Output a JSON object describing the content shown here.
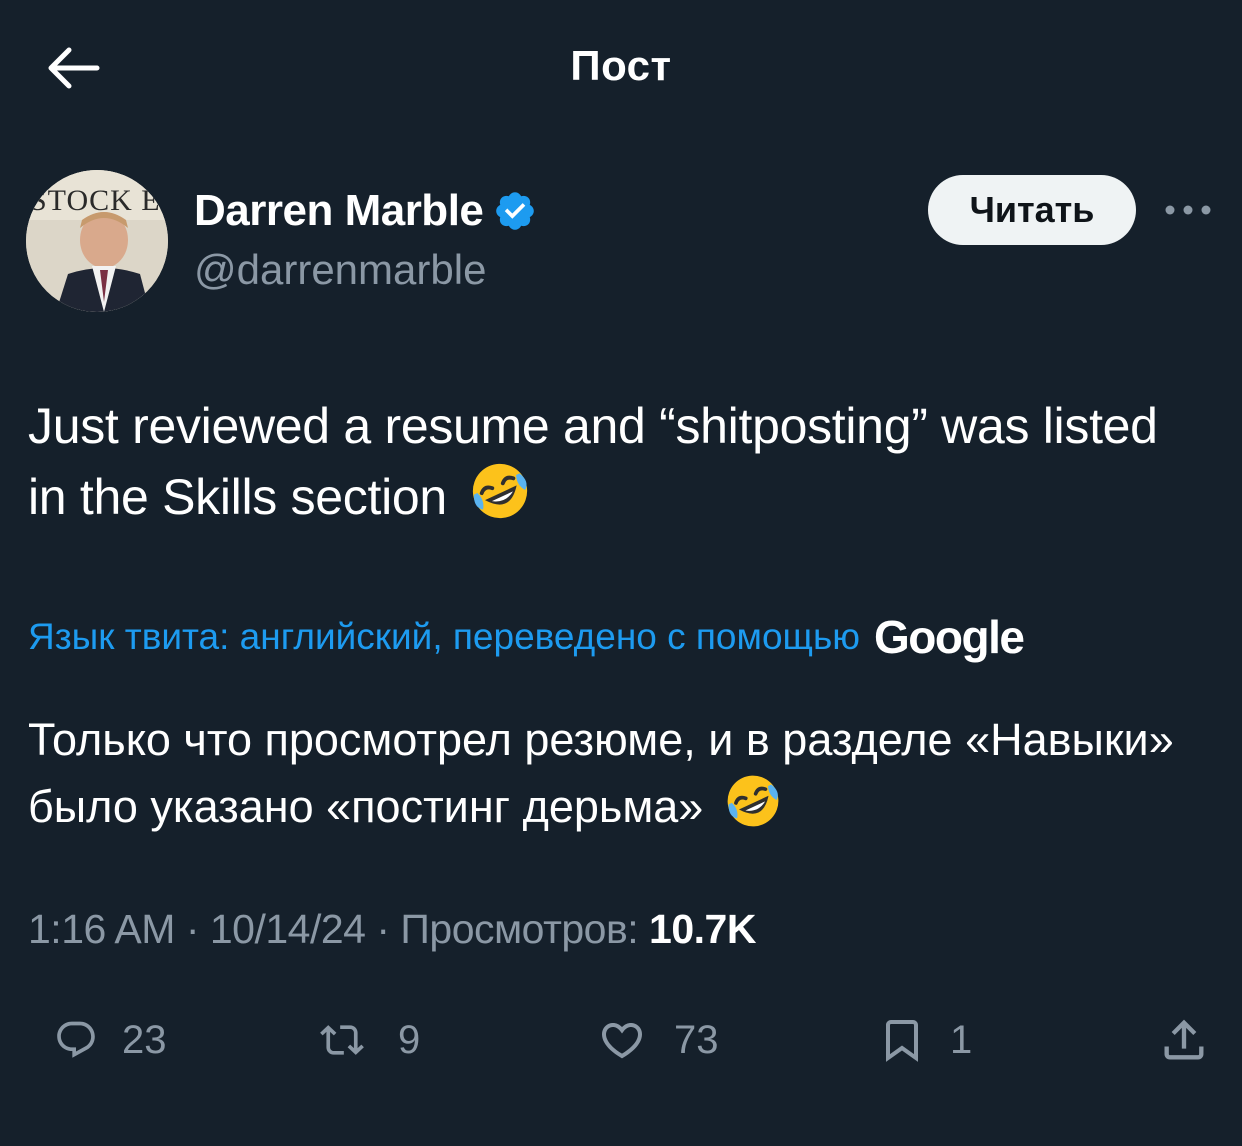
{
  "header": {
    "title": "Пост"
  },
  "author": {
    "name": "Darren Marble",
    "handle": "@darrenmarble",
    "verified": true,
    "follow_label": "Читать",
    "avatar_sign_text": "STOCK E"
  },
  "tweet": {
    "text": "Just reviewed a resume and “shitposting” was listed in the Skills section",
    "emoji": "rolling-on-the-floor-laughing"
  },
  "translation": {
    "notice": "Язык твита: английский, переведено с помощью",
    "provider": "Google",
    "text": "Только что просмотрел резюме, и в разделе «Навыки» было указано «постинг дерьма»"
  },
  "meta": {
    "time": "1:16 AM",
    "date": "10/14/24",
    "separator": " · ",
    "views_label": "Просмотров:",
    "views_count": "10.7K"
  },
  "actions": {
    "replies": "23",
    "reposts": "9",
    "likes": "73",
    "bookmarks": "1"
  },
  "colors": {
    "background": "#15202b",
    "link": "#1d9bf0",
    "secondary_text": "#8b98a5",
    "verified_badge": "#1d9bf0",
    "follow_button_bg": "#eff3f4"
  }
}
